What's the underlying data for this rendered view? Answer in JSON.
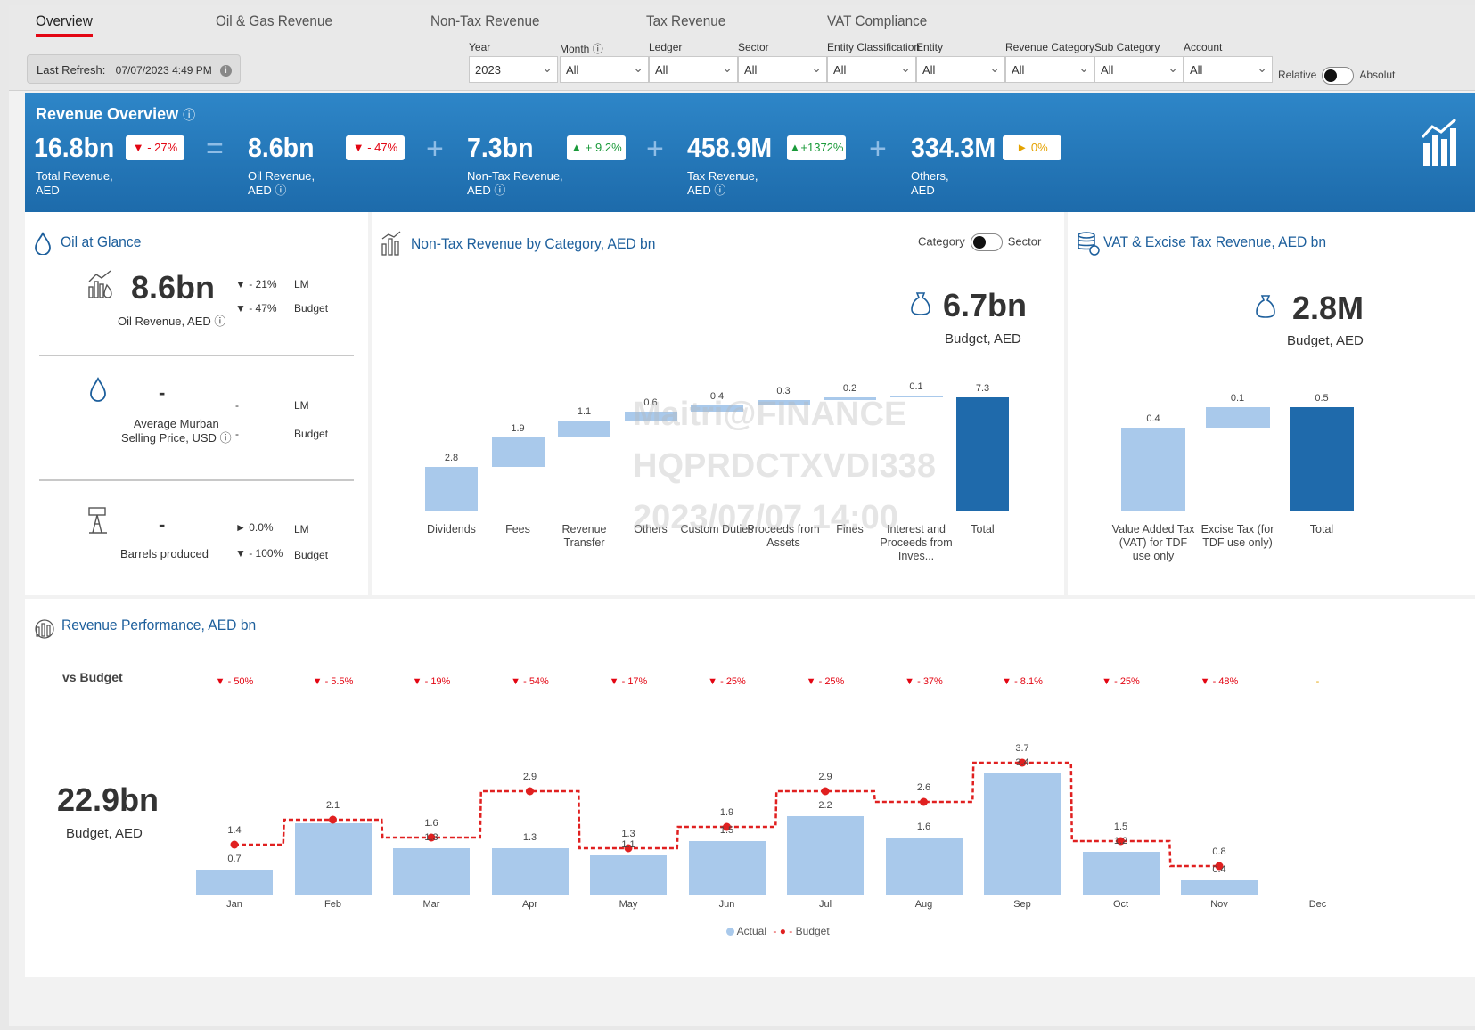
{
  "tabs": [
    {
      "label": "Overview",
      "active": true
    },
    {
      "label": "Oil & Gas Revenue"
    },
    {
      "label": "Non-Tax Revenue"
    },
    {
      "label": "Tax Revenue"
    },
    {
      "label": "VAT Compliance"
    }
  ],
  "refresh": {
    "label": "Last Refresh:",
    "value": "07/07/2023 4:49 PM"
  },
  "filters": [
    {
      "label": "Year",
      "value": "2023"
    },
    {
      "label": "Month",
      "value": "All"
    },
    {
      "label": "Ledger",
      "value": "All"
    },
    {
      "label": "Sector",
      "value": "All"
    },
    {
      "label": "Entity Classification",
      "value": "All"
    },
    {
      "label": "Entity",
      "value": "All"
    },
    {
      "label": "Revenue Category",
      "value": "All"
    },
    {
      "label": "Sub Category",
      "value": "All"
    },
    {
      "label": "Account",
      "value": "All"
    }
  ],
  "mode_toggle": {
    "left": "Relative",
    "right": "Absolut"
  },
  "overview": {
    "title": "Revenue Overview",
    "kpis": [
      {
        "value": "16.8bn",
        "label1": "Total Revenue,",
        "label2": "AED",
        "badge": "▼ - 27%",
        "tone": "red"
      },
      {
        "value": "8.6bn",
        "label1": "Oil Revenue,",
        "label2": "AED",
        "badge": "▼ - 47%",
        "tone": "red"
      },
      {
        "value": "7.3bn",
        "label1": "Non-Tax Revenue,",
        "label2": "AED",
        "badge": "▲ + 9.2%",
        "tone": "green"
      },
      {
        "value": "458.9M",
        "label1": "Tax Revenue,",
        "label2": "AED",
        "badge": "▲+1372%",
        "tone": "green"
      },
      {
        "value": "334.3M",
        "label1": "Others,",
        "label2": "AED",
        "badge": "► 0%",
        "tone": "amber"
      }
    ],
    "ops": [
      "=",
      "+",
      "+",
      "+"
    ]
  },
  "oil": {
    "title": "Oil at Glance",
    "revenue_value": "8.6bn",
    "revenue_label": "Oil Revenue, AED",
    "revenue_lm": "▼ - 21%",
    "revenue_budget": "▼ - 47%",
    "price_value": "-",
    "price_label1": "Average Murban",
    "price_label2": "Selling Price, USD",
    "price_lm": "-",
    "price_budget": "-",
    "barrels_value": "-",
    "barrels_label": "Barrels produced",
    "barrels_lm": "► 0.0%",
    "barrels_budget": "▼ - 100%",
    "lm_label": "LM",
    "budget_label": "Budget"
  },
  "nontax": {
    "title": "Non-Tax Revenue by Category, AED bn",
    "toggle_left": "Category",
    "toggle_right": "Sector",
    "budget_value": "6.7bn",
    "budget_label": "Budget, AED",
    "watermark": [
      "Maitri@FINANCE",
      "HQPRDCTXVDI338",
      "2023/07/07 14:00"
    ]
  },
  "vat": {
    "title": "VAT & Excise Tax Revenue, AED bn",
    "budget_value": "2.8M",
    "budget_label": "Budget, AED"
  },
  "performance": {
    "title": "Revenue Performance, AED bn",
    "vs_label": "vs Budget",
    "budget_value": "22.9bn",
    "budget_label": "Budget, AED",
    "variances": [
      "▼ - 50%",
      "▼ - 5.5%",
      "▼ - 19%",
      "▼ - 54%",
      "▼ - 17%",
      "▼ - 25%",
      "▼ - 25%",
      "▼ - 37%",
      "▼ - 8.1%",
      "▼ - 25%",
      "▼ - 48%",
      "-"
    ],
    "legend_actual": "Actual",
    "legend_budget": "Budget"
  },
  "colors": {
    "accent": "#1d5f9c",
    "bar_light": "#a9c9eb",
    "bar_dark": "#1f6aab",
    "budget_line": "#e02020",
    "negative": "#e30613"
  },
  "chart_data": [
    {
      "type": "bar",
      "chart_kind": "waterfall",
      "title": "Non-Tax Revenue by Category, AED bn",
      "categories": [
        "Dividends",
        "Fees",
        "Revenue Transfer",
        "Others",
        "Custom Duties",
        "Proceeds from Assets",
        "Fines",
        "Interest and Proceeds from Inves...",
        "Total"
      ],
      "values": [
        2.8,
        1.9,
        1.1,
        0.6,
        0.4,
        0.3,
        0.2,
        0.1,
        7.3
      ]
    },
    {
      "type": "bar",
      "chart_kind": "waterfall",
      "title": "VAT & Excise Tax Revenue, AED bn",
      "categories": [
        "Value Added Tax (VAT) for TDF use only",
        "Excise Tax (for TDF use only)",
        "Total"
      ],
      "values": [
        0.4,
        0.1,
        0.5
      ]
    },
    {
      "type": "bar",
      "title": "Revenue Performance, AED bn",
      "categories": [
        "Jan",
        "Feb",
        "Mar",
        "Apr",
        "May",
        "Jun",
        "Jul",
        "Aug",
        "Sep",
        "Oct",
        "Nov",
        "Dec"
      ],
      "series": [
        {
          "name": "Actual",
          "type": "bar",
          "values": [
            0.7,
            2.0,
            1.3,
            1.3,
            1.1,
            1.5,
            2.2,
            1.6,
            3.4,
            1.2,
            0.4,
            null
          ]
        },
        {
          "name": "Budget",
          "type": "line",
          "values": [
            1.4,
            2.1,
            1.6,
            2.9,
            1.3,
            1.9,
            2.9,
            2.6,
            3.7,
            1.5,
            0.8,
            null
          ]
        }
      ],
      "labels": {
        "actual": [
          "0.7",
          "",
          "1.3",
          "1.3",
          "1.1",
          "1.5",
          "2.2",
          "1.6",
          "3.4",
          "1.2",
          "0.4",
          ""
        ],
        "budget": [
          "1.4",
          "2.1",
          "1.6",
          "2.9",
          "1.3",
          "1.9",
          "2.9",
          "2.6",
          "3.7",
          "1.5",
          "0.8",
          ""
        ]
      }
    }
  ]
}
